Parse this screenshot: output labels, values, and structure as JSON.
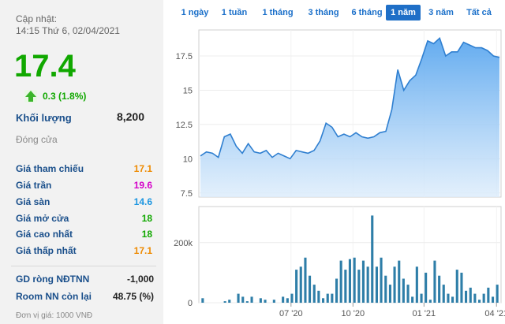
{
  "update": {
    "label": "Cập nhật:",
    "time": "14:15 Thứ 6, 02/04/2021"
  },
  "quote": {
    "price": "17.4",
    "change": "0.3 (1.8%)",
    "volume_label": "Khối lượng",
    "volume_value": "8,200",
    "close_label": "Đóng cửa"
  },
  "stats": [
    {
      "label": "Giá tham chiếu",
      "value": "17.1",
      "color": "#ee8a00"
    },
    {
      "label": "Giá trần",
      "value": "19.6",
      "color": "#d400c8"
    },
    {
      "label": "Giá sàn",
      "value": "14.6",
      "color": "#1b95e0"
    },
    {
      "label": "Giá mở cửa",
      "value": "18",
      "color": "#11a800"
    },
    {
      "label": "Giá cao nhất",
      "value": "18",
      "color": "#11a800"
    },
    {
      "label": "Giá thấp nhất",
      "value": "17.1",
      "color": "#ee8a00"
    }
  ],
  "foreign": [
    {
      "label": "GD ròng NĐTNN",
      "value": "-1,000"
    },
    {
      "label": "Room NN còn lại",
      "value": "48.75 (%)"
    }
  ],
  "unit_note": "Đơn vị giá: 1000 VNĐ",
  "periods": [
    {
      "label": "1 ngày",
      "active": false
    },
    {
      "label": "1 tuần",
      "active": false
    },
    {
      "label": "1 tháng",
      "active": false
    },
    {
      "label": "3 tháng",
      "active": false
    },
    {
      "label": "6 tháng",
      "active": false
    },
    {
      "label": "1 năm",
      "active": true
    },
    {
      "label": "3 năm",
      "active": false
    },
    {
      "label": "Tất cả",
      "active": false
    }
  ],
  "colors": {
    "up": "#11a800",
    "link": "#1a4f8b",
    "accent": "#1f6fc7",
    "line": "#2f7fd0",
    "bar": "#2e7ea8"
  },
  "chart_data": [
    {
      "type": "area",
      "x_tick_labels": [
        "07 '20",
        "10 '20",
        "01 '21",
        "04 '21"
      ],
      "y_tick_labels": [
        "7.5",
        "10",
        "12.5",
        "15",
        "17.5"
      ],
      "ylim": [
        7.2,
        19.4
      ],
      "y": [
        10.2,
        10.5,
        10.4,
        10.1,
        11.6,
        11.8,
        10.9,
        10.4,
        11.1,
        10.5,
        10.4,
        10.6,
        10.1,
        10.4,
        10.2,
        10.0,
        10.6,
        10.5,
        10.4,
        10.6,
        11.3,
        12.6,
        12.3,
        11.6,
        11.8,
        11.6,
        11.9,
        11.6,
        11.5,
        11.6,
        11.9,
        12.0,
        13.6,
        16.5,
        15.0,
        15.7,
        16.1,
        17.3,
        18.6,
        18.4,
        18.8,
        17.5,
        17.8,
        17.8,
        18.5,
        18.3,
        18.1,
        18.1,
        17.9,
        17.5,
        17.4
      ],
      "grid": true
    },
    {
      "type": "bar",
      "x_tick_labels": [
        "07 '20",
        "10 '20",
        "01 '21",
        "04 '21"
      ],
      "y_tick_labels": [
        "0",
        "200k"
      ],
      "ylim": [
        0,
        320000
      ],
      "values": [
        15000,
        0,
        0,
        0,
        0,
        5000,
        10000,
        0,
        30000,
        20000,
        5000,
        20000,
        0,
        15000,
        10000,
        0,
        10000,
        0,
        20000,
        15000,
        30000,
        110000,
        120000,
        150000,
        90000,
        60000,
        40000,
        15000,
        30000,
        30000,
        80000,
        140000,
        110000,
        145000,
        150000,
        110000,
        140000,
        120000,
        290000,
        120000,
        150000,
        90000,
        60000,
        120000,
        140000,
        80000,
        60000,
        20000,
        120000,
        30000,
        100000,
        10000,
        140000,
        90000,
        60000,
        30000,
        20000,
        110000,
        100000,
        40000,
        50000,
        30000,
        10000,
        30000,
        50000,
        20000,
        60000
      ]
    }
  ]
}
